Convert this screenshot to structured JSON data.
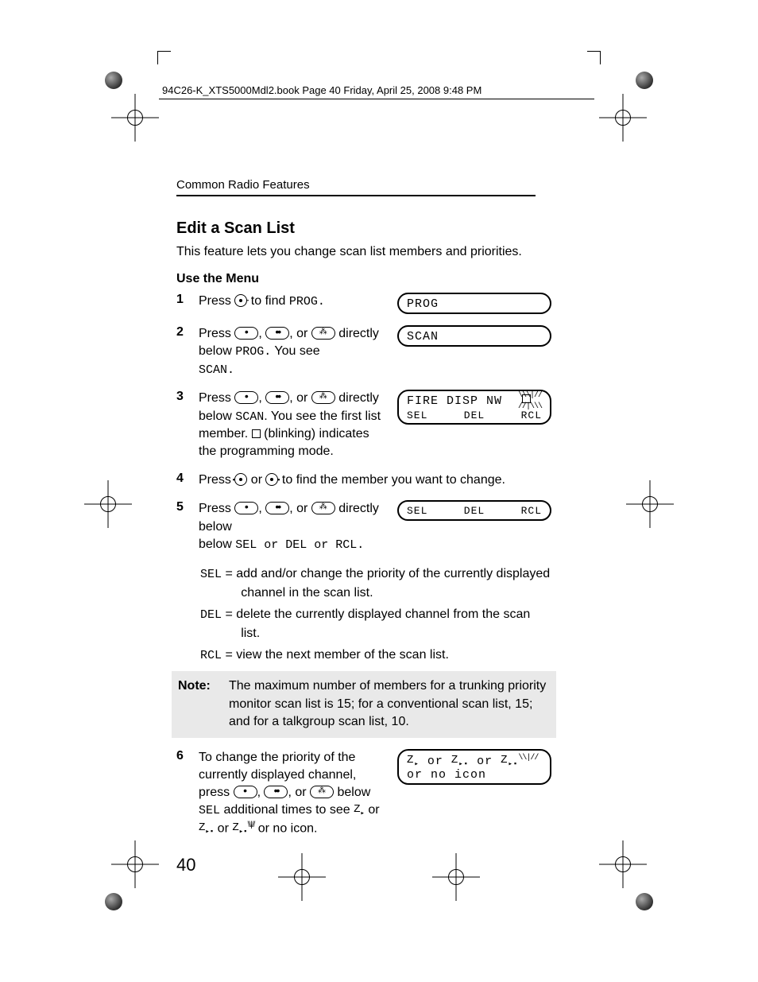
{
  "header": {
    "line": "94C26-K_XTS5000Mdl2.book  Page 40  Friday, April 25, 2008  9:48 PM"
  },
  "section": "Common Radio Features",
  "title": "Edit a Scan List",
  "intro": "This feature lets you change scan list members and priorities.",
  "subheading": "Use the Menu",
  "steps": [
    {
      "n": "1",
      "pre": "Press ",
      "post": " to find ",
      "tail": "PROG.",
      "display": "PROG"
    },
    {
      "n": "2",
      "pre": "Press ",
      "mid": "directly below ",
      "code": "PROG.",
      "after": " You see",
      "last": "SCAN.",
      "display": "SCAN"
    },
    {
      "n": "3",
      "pre": "Press ",
      "mid": "directly below ",
      "code": "SCAN",
      "after": ". You see the first list member. ",
      "blinkText": "(blinking) indicates the programming mode.",
      "display_top": "FIRE DISP NW",
      "soft": [
        "SEL",
        "DEL",
        "RCL"
      ]
    },
    {
      "n": "4",
      "pre": "Press ",
      "mid": " or ",
      "post": " to find the member you want to change."
    },
    {
      "n": "5",
      "pre": "Press ",
      "post": " directly below ",
      "opts": "SEL or DEL or RCL.",
      "soft": [
        "SEL",
        "DEL",
        "RCL"
      ]
    }
  ],
  "defs": {
    "sel_label": "SEL",
    "sel": " = add and/or change the priority of the currently displayed channel in the scan list.",
    "del_label": "DEL",
    "del": " = delete the currently displayed channel from the scan list.",
    "rcl_label": "RCL",
    "rcl": " = view the next member of the scan list."
  },
  "note": {
    "label": "Note:",
    "text": "The maximum number of members for a trunking priority monitor scan list is 15; for a conventional scan list, 15; and for a talkgroup scan list, 10."
  },
  "step6": {
    "n": "6",
    "a": "To change the priority of the currently displayed channel, press ",
    "b": " below ",
    "code": "SEL",
    "c": " additional times to see ",
    "tail": " or no icon.",
    "disp_tail": "or no icon"
  },
  "page_number": "40",
  "icons": {
    "z": "Z",
    "z_dot": "Z·",
    "z_blink": "Z"
  }
}
